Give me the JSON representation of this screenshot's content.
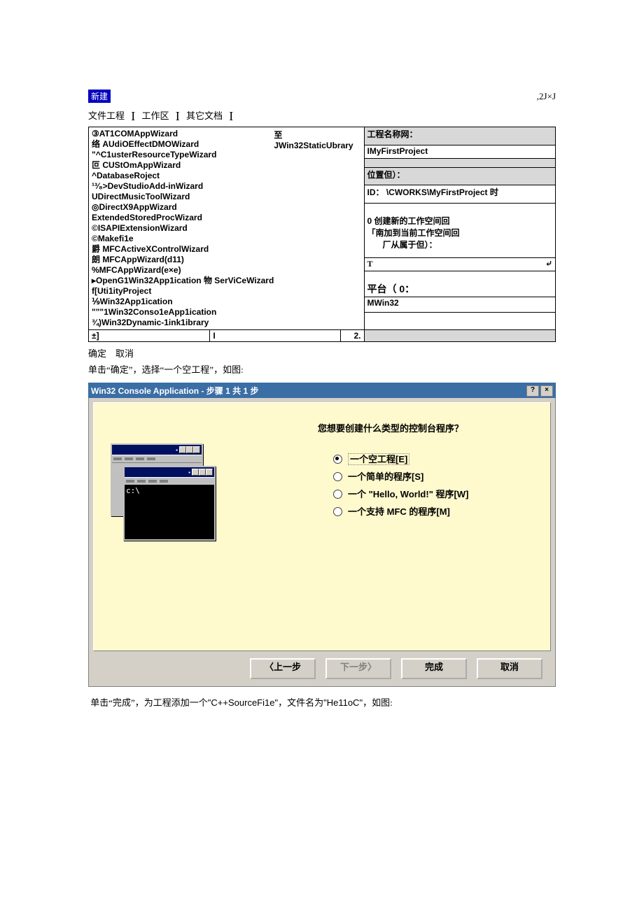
{
  "top": {
    "new_label": "新建",
    "corner": ",2J×J"
  },
  "tabs": {
    "t1": "文件工程",
    "t2": "工作区",
    "t3": "其它文档"
  },
  "wizards": [
    "③AT1COMAppWizard",
    "络 AUdiOEffectDMOWizard",
    "\"^C1usterResourceTypeWizard",
    "叵 CUStOmAppWizard",
    "^DatabaseRoject",
    "¹³⁄₈>DevStudioAdd-inWizard",
    "UDirectMusicToolWizard",
    "◎DirectX9AppWizard",
    "    ExtendedStoredProcWizard",
    "©ISAPIExtensionWizard",
    "©Makefi1e",
    "爵 MFCActiveXControlWizard",
    "朗 MFCAppWizard(d11)",
    "%MFCAppWizard(e×e)",
    "▸OpenG1Win32App1ication 物 SerViCeWizard",
    "f[Uti1ityProject",
    "⅑Win32App1ication",
    "\"\"\"1Win32Conso1eApp1ication",
    "¾)Win32Dynamic-1ink1ibrary"
  ],
  "wizards_right": "至 JWin32StaticUbrary",
  "leftbottom": {
    "l": "±]",
    "c": "I",
    "r": "2."
  },
  "side": {
    "name_label": "工程名称网：",
    "name_value": "IMyFirstProject",
    "loc_label": "位置但）：",
    "loc_value": "ID： \\CWORKS\\MyFirstProject    时",
    "opt_new": "0 创建新的工作空间回",
    "opt_add": "「南加到当前工作空间回",
    "opt_sub": "厂从属于但）：",
    "plat_label": "平台（ 0：",
    "plat_value": "MWin32",
    "t_sym": "T",
    "a_sym": "⤶"
  },
  "btns": {
    "ok": "确定",
    "cancel": "取消"
  },
  "para1": "单击“确定”，选择“一个空工程”，如图:",
  "wizard2": {
    "title": "Win32 Console Application - 步骤 1 共 1 步",
    "sys_help": "?",
    "sys_close": "×",
    "prompt": "c:\\",
    "question": "您想要创建什么类型的控制台程序？",
    "o1": "一个空工程[E]",
    "o2": "一个简单的程序[S]",
    "o3": "一个 \"Hello, World!\" 程序[W]",
    "o4": "一个支持 MFC 的程序[M]",
    "back": "〈上一步",
    "next": "下一步〉",
    "finish": "完成",
    "cancel": "取消"
  },
  "para2_pre": "单击“完成”，为工程添加一个",
  "para2_code": "\"C++SourceFi1e\"",
  "para2_mid": "，文件名为",
  "para2_name": "\"He11oC\"",
  "para2_end": "，如图:"
}
